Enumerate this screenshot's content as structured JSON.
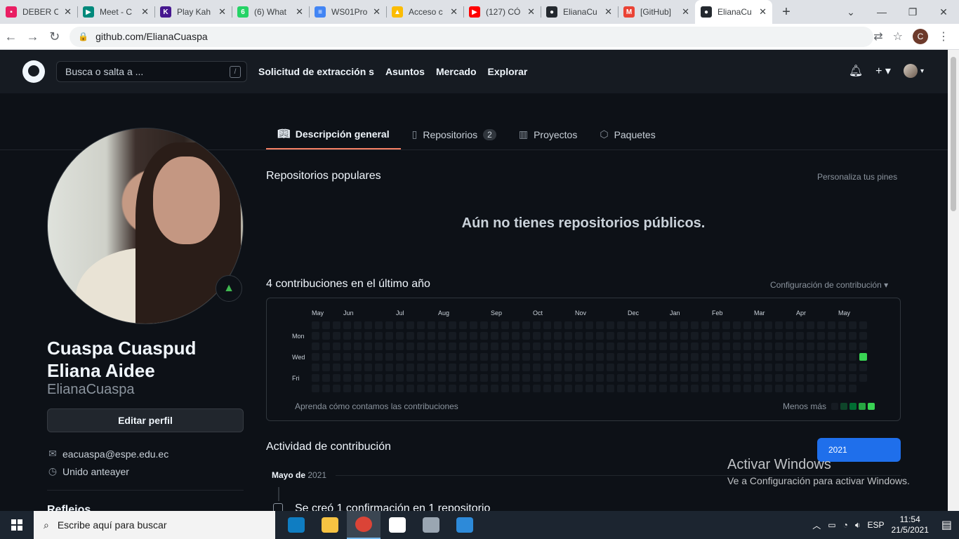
{
  "browser": {
    "tabs": [
      {
        "label": "DEBER C",
        "color": "#e91e63",
        "glyph": "▪"
      },
      {
        "label": "Meet - C",
        "color": "#00897b",
        "glyph": "▶"
      },
      {
        "label": "Play Kah",
        "color": "#46178f",
        "glyph": "K"
      },
      {
        "label": "(6) What",
        "color": "#25d366",
        "glyph": "6"
      },
      {
        "label": "WS01Pro",
        "color": "#4285f4",
        "glyph": "≡"
      },
      {
        "label": "Acceso c",
        "color": "#fbbc04",
        "glyph": "▲"
      },
      {
        "label": "(127) CÓ",
        "color": "#ff0000",
        "glyph": "▶"
      },
      {
        "label": "ElianaCu",
        "color": "#24292f",
        "glyph": "●"
      },
      {
        "label": "[GitHub]",
        "color": "#ea4335",
        "glyph": "M"
      },
      {
        "label": "ElianaCu",
        "color": "#24292f",
        "glyph": "●",
        "active": true
      }
    ],
    "new_tab": "+",
    "url": "github.com/ElianaCuaspa",
    "profile_initial": "C"
  },
  "header": {
    "search_placeholder": "Busca o salta a ...",
    "search_key": "/",
    "nav": [
      "Solicitud de extracción s",
      "Asuntos",
      "Mercado",
      "Explorar"
    ]
  },
  "tabs": [
    {
      "label": "Descripción general",
      "icon": "book-icon"
    },
    {
      "label": "Repositorios",
      "count": "2",
      "icon": "repo-icon"
    },
    {
      "label": "Proyectos",
      "icon": "project-icon"
    },
    {
      "label": "Paquetes",
      "icon": "package-icon"
    }
  ],
  "profile": {
    "full_name": "Cuaspa Cuaspud Eliana Aidee",
    "login": "ElianaCuaspa",
    "edit_label": "Editar perfil",
    "email": "eacuaspa@espe.edu.ec",
    "joined": "Unido anteayer",
    "highlights_title": "Reflejos"
  },
  "pinned": {
    "title": "Repositorios populares",
    "customize": "Personaliza tus pines",
    "empty": "Aún no tienes repositorios públicos."
  },
  "contributions": {
    "title": "4 contribuciones en el último año",
    "settings": "Configuración de contribución",
    "months": [
      "May",
      "Jun",
      "Jul",
      "Aug",
      "Sep",
      "Oct",
      "Nov",
      "Dec",
      "Jan",
      "Feb",
      "Mar",
      "Apr",
      "May"
    ],
    "days": [
      "Mon",
      "Wed",
      "Fri"
    ],
    "learn": "Aprenda cómo contamos las contribuciones",
    "legend_less_more": "Menos más",
    "colors": {
      "empty": "#161b22",
      "l1": "#0e4429",
      "l2": "#006d32",
      "l3": "#26a641",
      "l4": "#39d353"
    },
    "active_cell": {
      "week": 52,
      "day": 3,
      "level": "l4"
    }
  },
  "activity": {
    "title": "Actividad de contribución",
    "year": "2021",
    "month": "Mayo de",
    "month_year": "2021",
    "commit": "Se creó 1 confirmación en 1 repositorio"
  },
  "watermark": {
    "title": "Activar Windows",
    "subtitle": "Ve a Configuración para activar Windows."
  },
  "taskbar": {
    "search": "Escribe aquí para buscar",
    "apps": [
      {
        "name": "edge",
        "color": "#0f7dc2"
      },
      {
        "name": "explorer",
        "color": "#f6c342"
      },
      {
        "name": "chrome",
        "color": "#db4437",
        "active": true
      },
      {
        "name": "store",
        "color": "#ffffff"
      },
      {
        "name": "camera",
        "color": "#9aa6b2"
      },
      {
        "name": "photos",
        "color": "#2d8ad9"
      }
    ],
    "lang": "ESP",
    "time": "11:54",
    "date": "21/5/2021"
  }
}
